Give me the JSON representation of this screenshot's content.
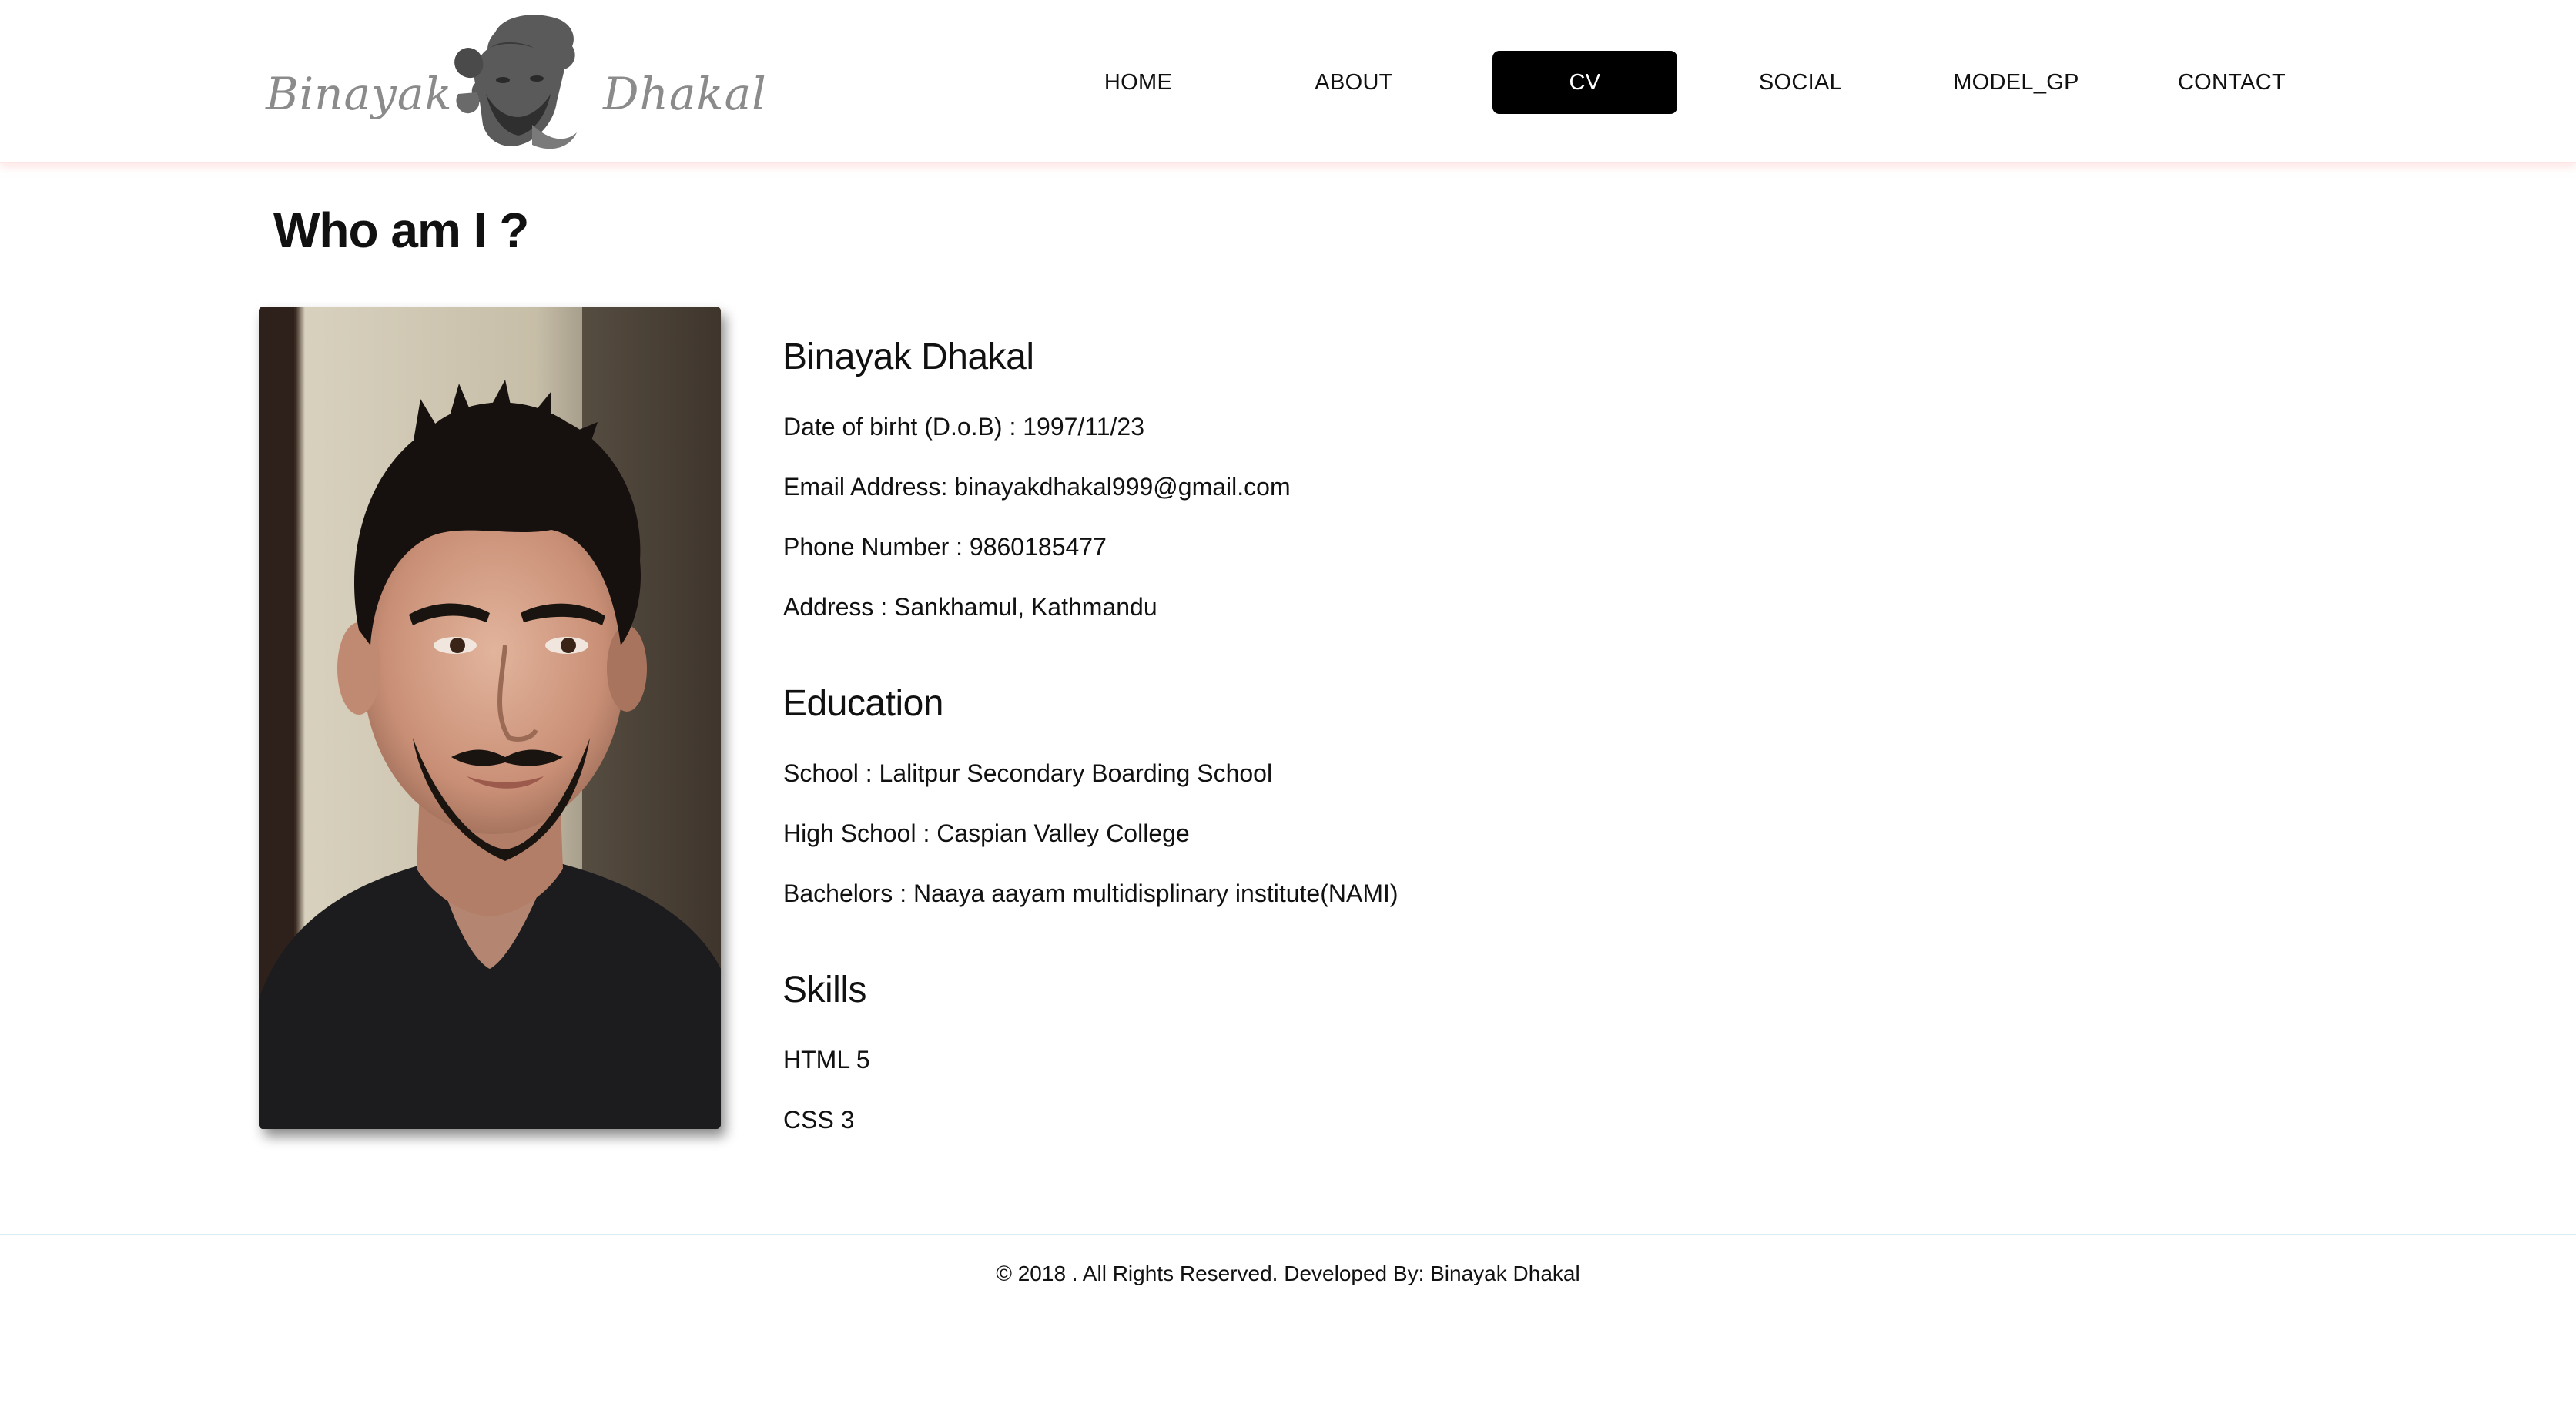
{
  "logo": {
    "first_name": "Binayak",
    "last_name": "Dhakal"
  },
  "nav": {
    "items": [
      {
        "label": "HOME",
        "active": false
      },
      {
        "label": "ABOUT",
        "active": false
      },
      {
        "label": "CV",
        "active": true
      },
      {
        "label": "SOCIAL",
        "active": false
      },
      {
        "label": "MODEL_GP",
        "active": false
      },
      {
        "label": "CONTACT",
        "active": false
      }
    ]
  },
  "page": {
    "title": "Who am I ?"
  },
  "profile": {
    "name": "Binayak Dhakal",
    "dob": "Date of birht (D.o.B) : 1997/11/23",
    "email": "Email Address: binayakdhakal999@gmail.com",
    "phone": "Phone Number : 9860185477",
    "address": "Address : Sankhamul, Kathmandu"
  },
  "education": {
    "heading": "Education",
    "school": "School : Lalitpur Secondary Boarding School",
    "high_school": "High School : Caspian Valley College",
    "bachelors": "Bachelors : Naaya aayam multidisplinary institute(NAMI)"
  },
  "skills": {
    "heading": "Skills",
    "items": [
      "HTML 5",
      "CSS 3"
    ]
  },
  "footer": {
    "text": "© 2018 . All Rights Reserved. Developed By: Binayak Dhakal"
  },
  "colors": {
    "nav_active_bg": "#000000",
    "nav_active_text": "#ffffff",
    "header_shadow": "#fde6e6",
    "footer_rule": "#d9ecf5"
  }
}
